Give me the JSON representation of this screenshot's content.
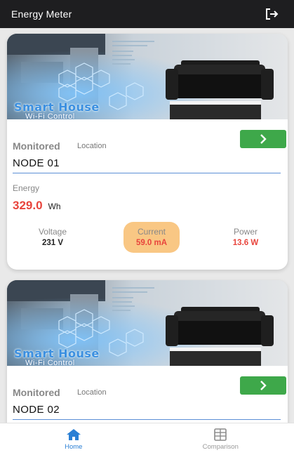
{
  "app": {
    "title": "Energy Meter"
  },
  "banner": {
    "title": "Smart House",
    "subtitle": "Wi-Fi Control"
  },
  "cards": [
    {
      "monitored_label": "Monitored",
      "location_label": "Location",
      "node": "NODE 01",
      "energy_label": "Energy",
      "energy_value": "329.0",
      "energy_unit": "Wh",
      "voltage_label": "Voltage",
      "voltage_value": "231 V",
      "current_label": "Current",
      "current_value": "59.0 mA",
      "power_label": "Power",
      "power_value": "13.6 W"
    },
    {
      "monitored_label": "Monitored",
      "location_label": "Location",
      "node": "NODE 02"
    }
  ],
  "nav": {
    "home": "Home",
    "comparison": "Comparison"
  },
  "colors": {
    "appbar": "#1e1e20",
    "go_button": "#3ea84a",
    "energy_value": "#e8443c",
    "current_highlight": "#f9c784",
    "nav_active": "#2a7fd4"
  },
  "icons": [
    "logout-icon",
    "chevron-right-icon",
    "home-icon",
    "comparison-icon"
  ]
}
